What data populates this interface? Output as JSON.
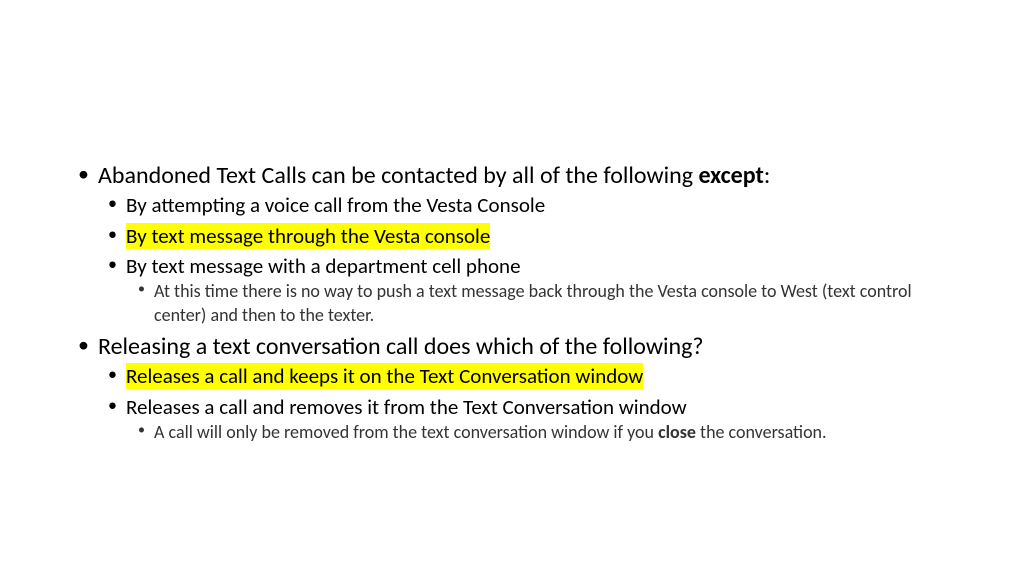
{
  "q1": {
    "stem_pre": "Abandoned Text Calls can be contacted by all of the following ",
    "stem_bold": "except",
    "stem_post": ":",
    "options": [
      {
        "text": "By attempting a voice call from the Vesta Console",
        "highlight": false
      },
      {
        "text": "By text message through the Vesta console",
        "highlight": true
      },
      {
        "text": "By text message with a department cell phone",
        "highlight": false
      }
    ],
    "note": "At this time there is no way to push a text message back through the Vesta console to West (text control center) and then to the texter."
  },
  "q2": {
    "stem": "Releasing a text conversation call does which of the following?",
    "options": [
      {
        "text": "Releases a call and keeps it on the Text Conversation window",
        "highlight": true
      },
      {
        "text": "Releases a call and removes it from the Text Conversation window",
        "highlight": false
      }
    ],
    "note_pre": "A call will only be removed from the text conversation window if you ",
    "note_bold": "close",
    "note_post": " the conversation."
  }
}
